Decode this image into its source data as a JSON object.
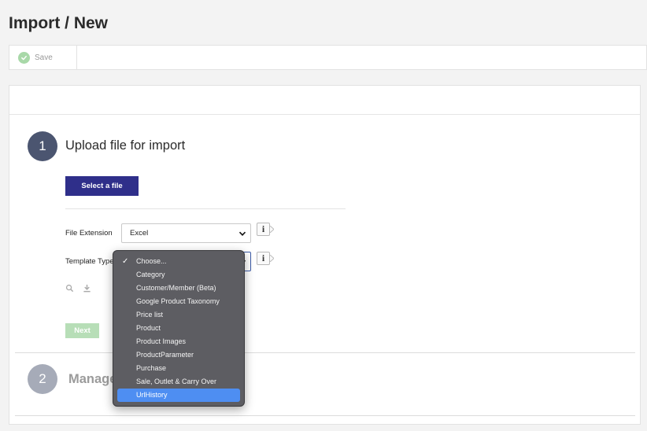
{
  "page": {
    "title": "Import / New"
  },
  "toolbar": {
    "save_label": "Save"
  },
  "step1": {
    "number": "1",
    "title": "Upload file for import",
    "select_file_label": "Select a file",
    "file_extension": {
      "label": "File Extension",
      "value": "Excel"
    },
    "template_type": {
      "label": "Template Type"
    },
    "next_label": "Next"
  },
  "step2": {
    "number": "2",
    "title": "Manage"
  },
  "dropdown": {
    "options": [
      "Choose...",
      "Category",
      "Customer/Member (Beta)",
      "Google Product Taxonomy",
      "Price list",
      "Product",
      "Product Images",
      "ProductParameter",
      "Purchase",
      "Sale, Outlet & Carry Over",
      "UrlHistory"
    ],
    "checked_option": "Choose...",
    "highlighted_option": "UrlHistory"
  },
  "icons": {
    "save": "check-circle-icon",
    "info": "info-icon",
    "search": "search-icon",
    "download": "download-icon",
    "chevron": "chevron-down-icon",
    "check": "checkmark-icon"
  },
  "colors": {
    "primary_button": "#2f2f8a",
    "step_active": "#4b5570",
    "step_inactive": "#a6abb8",
    "next_button": "#b7deb7",
    "highlight": "#4e8ef2"
  }
}
